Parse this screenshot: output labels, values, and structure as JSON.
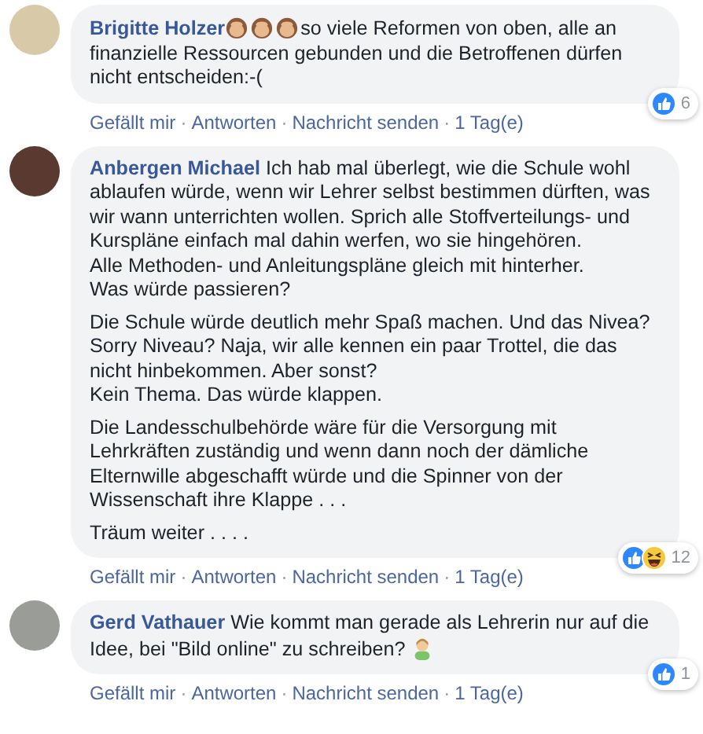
{
  "comments": [
    {
      "author": "Brigitte Holzer",
      "paragraphs": [
        [
          {
            "kind": "monkey"
          },
          {
            "kind": "monkey"
          },
          {
            "kind": "monkey"
          },
          {
            "kind": "text",
            "text": "so viele Reformen von oben, alle an finanzielle Ressourcen gebunden und die Betroffenen dürfen nicht entscheiden:-("
          }
        ]
      ],
      "reactions": [
        {
          "kind": "like"
        }
      ],
      "reaction_count": "6",
      "separator": "·",
      "actions": [
        "Gefällt mir",
        "Antworten",
        "Nachricht senden",
        "1 Tag(e)"
      ]
    },
    {
      "author": "Anbergen Michael",
      "paragraphs": [
        [
          {
            "kind": "text",
            "text": "Ich hab mal überlegt, wie die Schule wohl ablaufen würde, wenn wir Lehrer selbst bestimmen dürften, was wir wann unterrichten wollen. Sprich alle Stoffverteilungs- und Kurspläne einfach mal dahin werfen, wo sie hingehören.\nAlle Methoden- und Anleitungspläne gleich mit hinterher.\nWas würde passieren?"
          }
        ],
        [
          {
            "kind": "text",
            "text": "Die Schule würde deutlich mehr Spaß machen. Und das Nivea? Sorry Niveau? Naja, wir alle kennen ein paar Trottel, die das nicht hinbekommen. Aber sonst?\nKein Thema. Das würde klappen."
          }
        ],
        [
          {
            "kind": "text",
            "text": "Die Landesschulbehörde wäre für die Versorgung mit Lehrkräften zuständig und wenn dann noch der dämliche Elternwille abgeschafft würde und die Spinner von der Wissenschaft ihre Klappe . . ."
          }
        ],
        [
          {
            "kind": "text",
            "text": "Träum weiter . . . ."
          }
        ]
      ],
      "reactions": [
        {
          "kind": "like"
        },
        {
          "kind": "haha"
        }
      ],
      "reaction_count": "12",
      "separator": "·",
      "actions": [
        "Gefällt mir",
        "Antworten",
        "Nachricht senden",
        "1 Tag(e)"
      ]
    },
    {
      "author": "Gerd Vathauer",
      "paragraphs": [
        [
          {
            "kind": "text",
            "text": "Wie kommt man gerade als Lehrerin nur auf die Idee, bei \"Bild online\" zu schreiben?"
          },
          {
            "kind": "person"
          }
        ]
      ],
      "reactions": [
        {
          "kind": "like"
        }
      ],
      "reaction_count": "1",
      "separator": "·",
      "actions": [
        "Gefällt mir",
        "Antworten",
        "Nachricht senden",
        "1 Tag(e)"
      ]
    }
  ]
}
